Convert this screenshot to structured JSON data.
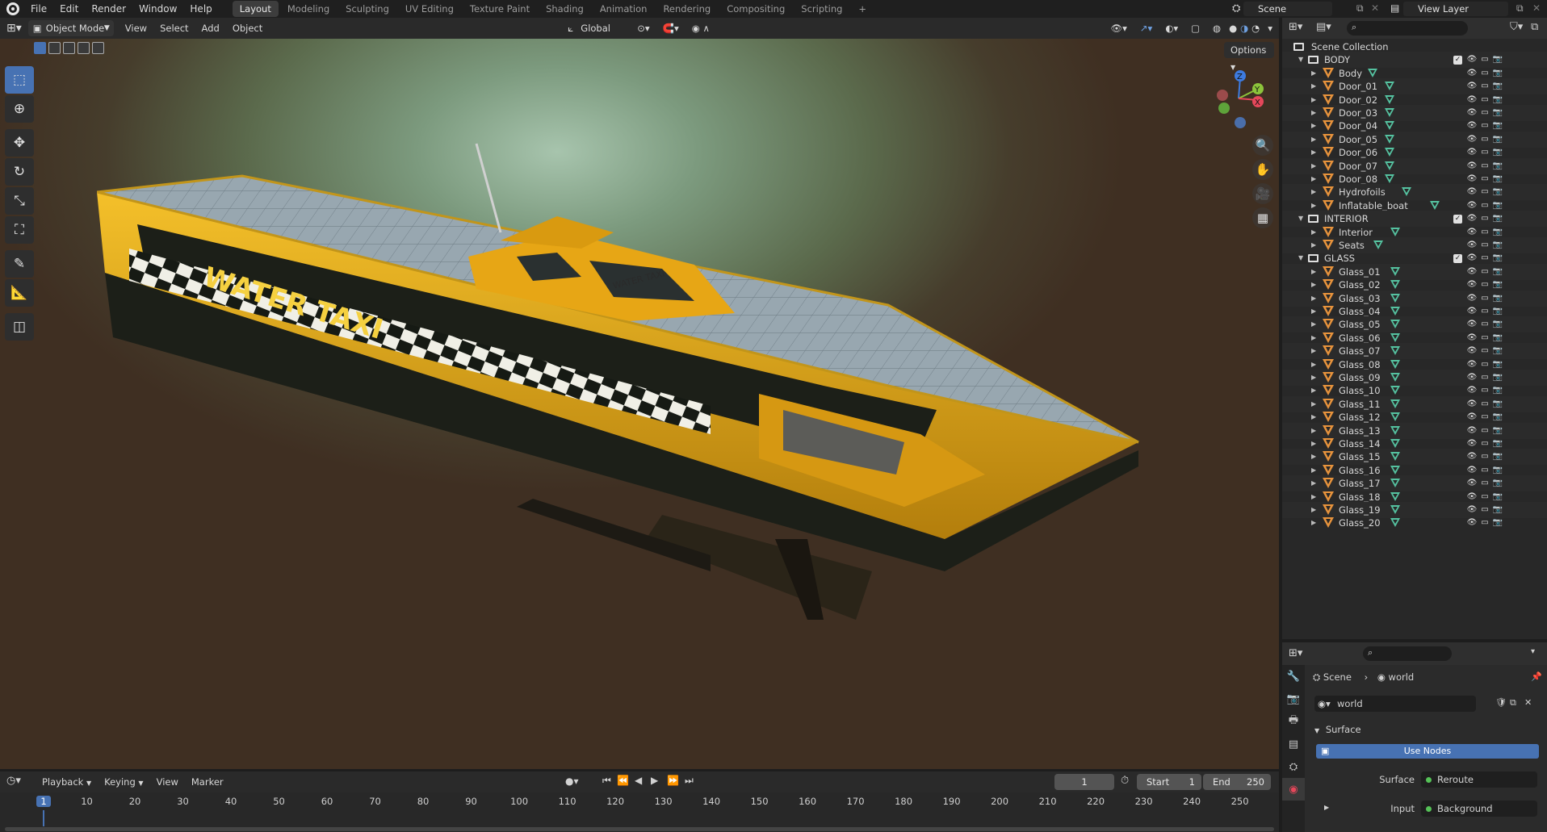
{
  "app": {
    "menu": [
      "File",
      "Edit",
      "Render",
      "Window",
      "Help"
    ],
    "workspaces": [
      "Layout",
      "Modeling",
      "Sculpting",
      "UV Editing",
      "Texture Paint",
      "Shading",
      "Animation",
      "Rendering",
      "Compositing",
      "Scripting"
    ],
    "active_workspace": "Layout",
    "add_workspace": "+",
    "scene": "Scene",
    "view_layer": "View Layer"
  },
  "viewport_header": {
    "mode": "Object Mode",
    "menus": [
      "View",
      "Select",
      "Add",
      "Object"
    ],
    "orientation": "Global",
    "options": "Options"
  },
  "gizmo": {
    "z": "Z",
    "y": "Y",
    "x": "X"
  },
  "outliner": {
    "root": "Scene Collection",
    "collections": [
      {
        "name": "BODY",
        "objects": [
          "Body",
          "Door_01",
          "Door_02",
          "Door_03",
          "Door_04",
          "Door_05",
          "Door_06",
          "Door_07",
          "Door_08",
          "Hydrofoils",
          "Inflatable_boat"
        ]
      },
      {
        "name": "INTERIOR",
        "objects": [
          "Interior",
          "Seats"
        ]
      },
      {
        "name": "GLASS",
        "objects": [
          "Glass_01",
          "Glass_02",
          "Glass_03",
          "Glass_04",
          "Glass_05",
          "Glass_06",
          "Glass_07",
          "Glass_08",
          "Glass_09",
          "Glass_10",
          "Glass_11",
          "Glass_12",
          "Glass_13",
          "Glass_14",
          "Glass_15",
          "Glass_16",
          "Glass_17",
          "Glass_18",
          "Glass_19",
          "Glass_20"
        ]
      }
    ]
  },
  "properties": {
    "breadcrumb_scene": "Scene",
    "breadcrumb_world": "world",
    "world_name": "world",
    "panel": "Surface",
    "use_nodes": "Use Nodes",
    "surface_label": "Surface",
    "surface_value": "Reroute",
    "input_label": "Input",
    "input_value": "Background"
  },
  "timeline": {
    "menus": [
      "Playback",
      "Keying",
      "View",
      "Marker"
    ],
    "current_frame": "1",
    "start_label": "Start",
    "start": "1",
    "end_label": "End",
    "end": "250",
    "ticks": [
      "1",
      "10",
      "20",
      "30",
      "40",
      "50",
      "60",
      "70",
      "80",
      "90",
      "100",
      "110",
      "120",
      "130",
      "140",
      "150",
      "160",
      "170",
      "180",
      "190",
      "200",
      "210",
      "220",
      "230",
      "240",
      "250"
    ]
  },
  "scene_content": {
    "hull_text": "WATER TAXI",
    "cabin_text": "WATER TAXI",
    "colors": {
      "hull_yellow": "#e8a712",
      "hull_dark": "#1c1f18",
      "deck_panel": "#8a9aa6",
      "accent_blue": "#4772b3"
    }
  }
}
